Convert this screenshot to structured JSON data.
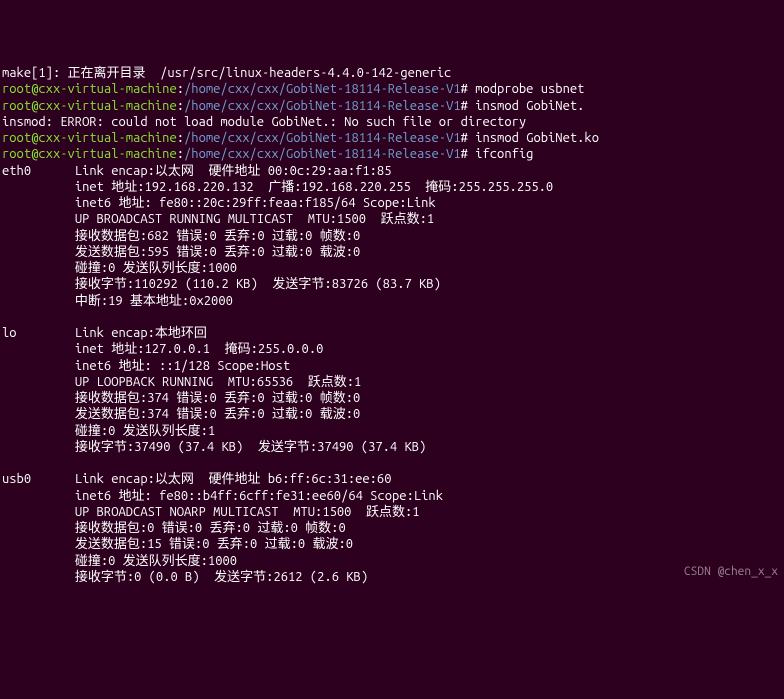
{
  "top_line": "make[1]: 正在离开目录  /usr/src/linux-headers-4.4.0-142-generic",
  "prompt": {
    "user": "root",
    "host": "cxx-virtual-machine",
    "path": "/home/cxx/cxx/GobiNet-18114-Release-V1",
    "suffix": "#"
  },
  "cmds": {
    "modprobe": "modprobe usbnet",
    "insmod_bad": "insmod GobiNet.",
    "insmod_err": "insmod: ERROR: could not load module GobiNet.: No such file or directory",
    "insmod_ok": "insmod GobiNet.ko",
    "ifconfig": "ifconfig"
  },
  "ifaces": {
    "eth0": {
      "name": "eth0",
      "l1": "Link encap:以太网  硬件地址 00:0c:29:aa:f1:85",
      "l2": "inet 地址:192.168.220.132  广播:192.168.220.255  掩码:255.255.255.0",
      "l3": "inet6 地址: fe80::20c:29ff:feaa:f185/64 Scope:Link",
      "l4": "UP BROADCAST RUNNING MULTICAST  MTU:1500  跃点数:1",
      "l5": "接收数据包:682 错误:0 丢弃:0 过载:0 帧数:0",
      "l6": "发送数据包:595 错误:0 丢弃:0 过载:0 载波:0",
      "l7": "碰撞:0 发送队列长度:1000",
      "l8": "接收字节:110292 (110.2 KB)  发送字节:83726 (83.7 KB)",
      "l9": "中断:19 基本地址:0x2000"
    },
    "lo": {
      "name": "lo",
      "l1": "Link encap:本地环回",
      "l2": "inet 地址:127.0.0.1  掩码:255.0.0.0",
      "l3": "inet6 地址: ::1/128 Scope:Host",
      "l4": "UP LOOPBACK RUNNING  MTU:65536  跃点数:1",
      "l5": "接收数据包:374 错误:0 丢弃:0 过载:0 帧数:0",
      "l6": "发送数据包:374 错误:0 丢弃:0 过载:0 载波:0",
      "l7": "碰撞:0 发送队列长度:1",
      "l8": "接收字节:37490 (37.4 KB)  发送字节:37490 (37.4 KB)"
    },
    "usb0": {
      "name": "usb0",
      "l1": "Link encap:以太网  硬件地址 b6:ff:6c:31:ee:60",
      "l2": "inet6 地址: fe80::b4ff:6cff:fe31:ee60/64 Scope:Link",
      "l3": "UP BROADCAST NOARP MULTICAST  MTU:1500  跃点数:1",
      "l4": "接收数据包:0 错误:0 丢弃:0 过载:0 帧数:0",
      "l5": "发送数据包:15 错误:0 丢弃:0 过载:0 载波:0",
      "l6": "碰撞:0 发送队列长度:1000",
      "l7": "接收字节:0 (0.0 B)  发送字节:2612 (2.6 KB)"
    }
  },
  "watermark": "CSDN @chen_x_x"
}
